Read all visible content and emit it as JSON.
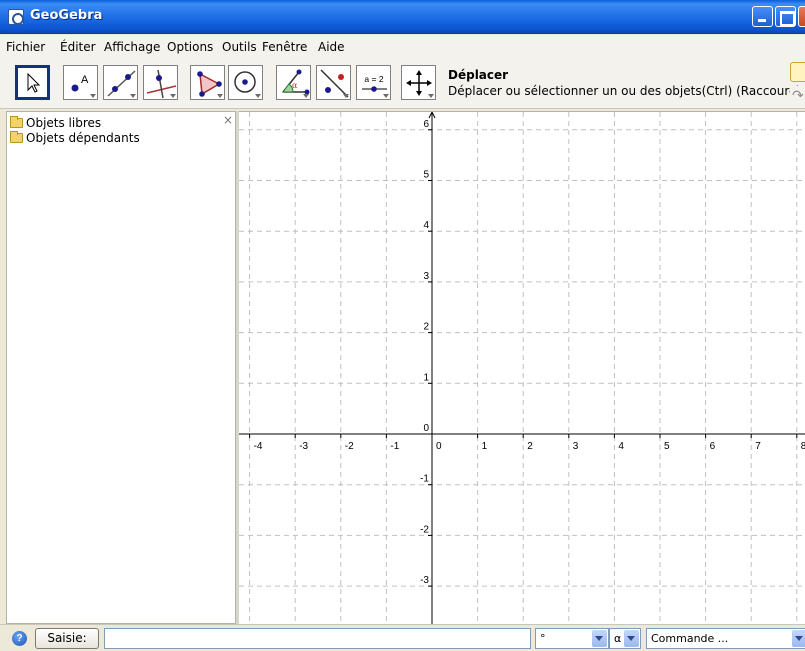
{
  "window": {
    "title": "GeoGebra"
  },
  "menu": [
    "Fichier",
    "Éditer",
    "Affichage",
    "Options",
    "Outils",
    "Fenêtre",
    "Aide"
  ],
  "toolbar": {
    "tools": [
      {
        "name": "move-tool",
        "icon": "cursor-arrow-icon"
      },
      {
        "name": "point-tool",
        "icon": "point-a-icon"
      },
      {
        "name": "line-tool",
        "icon": "line-through-points-icon"
      },
      {
        "name": "perpendicular-tool",
        "icon": "perpendicular-line-icon"
      },
      {
        "name": "polygon-tool",
        "icon": "polygon-icon"
      },
      {
        "name": "circle-tool",
        "icon": "circle-center-icon"
      },
      {
        "name": "angle-tool",
        "icon": "angle-alpha-icon"
      },
      {
        "name": "reflect-tool",
        "icon": "reflect-point-icon"
      },
      {
        "name": "slider-tool",
        "icon": "slider-a2-icon"
      },
      {
        "name": "move-view-tool",
        "icon": "move-graphics-view-icon"
      }
    ],
    "slider_label": "a = 2",
    "selected_tool_title": "Déplacer",
    "selected_tool_description": "Déplacer ou sélectionner un ou des objets(Ctrl) (Raccourci=Esc)"
  },
  "algebra": {
    "close_glyph": "×",
    "folders": [
      "Objets libres",
      "Objets dépendants"
    ]
  },
  "graphics": {
    "x_ticks": [
      -4,
      -3,
      -2,
      -1,
      0,
      1,
      2,
      3,
      4,
      5,
      6,
      7,
      8
    ],
    "y_ticks": [
      -3,
      -2,
      -1,
      1,
      2,
      3,
      4,
      5,
      6
    ],
    "grid": true,
    "grid_style": "dashed",
    "axes": true
  },
  "inputbar": {
    "help_glyph": "?",
    "saisie_label": "Saisie:",
    "input_value": "",
    "symbol_combo_value": "°",
    "greek_combo_value": "α",
    "command_combo_value": "Commande ..."
  }
}
